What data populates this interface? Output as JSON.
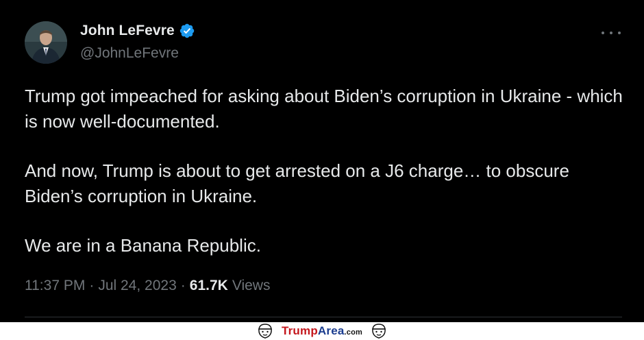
{
  "tweet": {
    "display_name": "John LeFevre",
    "handle": "@JohnLeFevre",
    "paragraphs": [
      "Trump got impeached for asking about Biden’s corruption in Ukraine - which is now well-documented.",
      "And now, Trump is about to get arrested on a J6 charge… to obscure Biden’s corruption in Ukraine.",
      "We are in a Banana Republic."
    ],
    "time": "11:37 PM",
    "date": "Jul 24, 2023",
    "views_count": "61.7K",
    "views_label": "Views",
    "separator": "·"
  },
  "watermark": {
    "brand_part1": "Trump",
    "brand_part2": "Area",
    "brand_suffix": ".com"
  },
  "icons": {
    "verified": "verified-badge-icon",
    "more": "more-options-icon"
  },
  "colors": {
    "background": "#000000",
    "text": "#e7e9ea",
    "secondary_text": "#71767b",
    "verified_blue": "#1d9bf0",
    "brand_red": "#c4161c",
    "brand_blue": "#1a3c8f"
  }
}
